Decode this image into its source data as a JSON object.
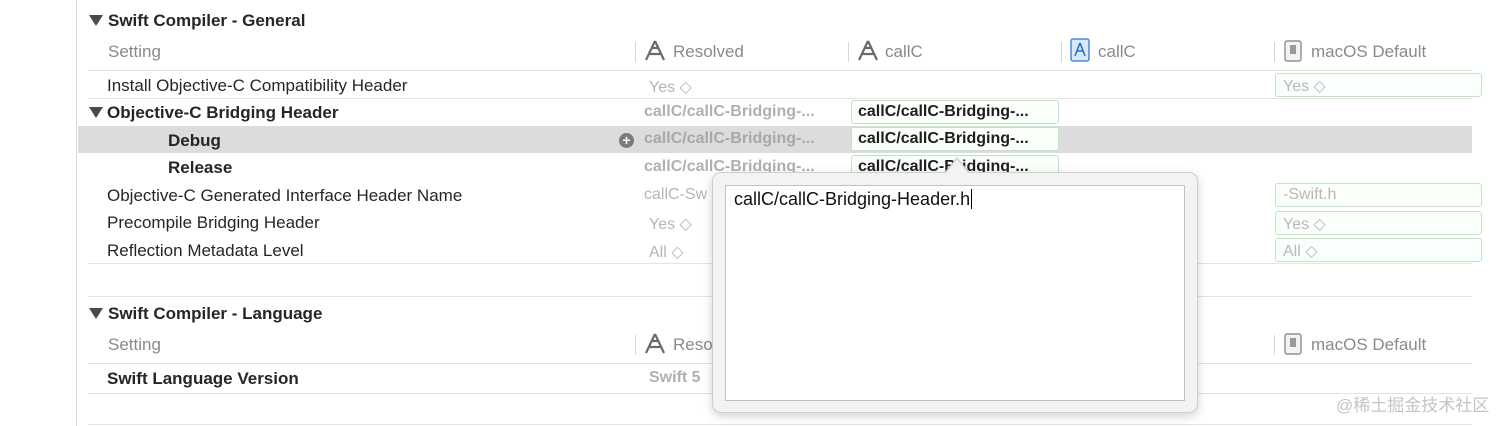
{
  "sections": {
    "general": {
      "title": "Swift Compiler - General",
      "header": {
        "setting": "Setting",
        "resolved": "Resolved",
        "target": "callC",
        "project": "callC",
        "default": "macOS Default"
      },
      "rows": {
        "install_header": {
          "label": "Install Objective-C Compatibility Header",
          "resolved": "Yes ◇",
          "default": "Yes ◇"
        },
        "bridging_header": {
          "label": "Objective-C Bridging Header",
          "resolved": "callC/callC-Bridging-...",
          "target": "callC/callC-Bridging-..."
        },
        "debug": {
          "label": "Debug",
          "resolved": "callC/callC-Bridging-...",
          "target": "callC/callC-Bridging-..."
        },
        "release": {
          "label": "Release",
          "resolved": "callC/callC-Bridging-...",
          "target": "callC/callC-Bridging-..."
        },
        "generated_interface": {
          "label": "Objective-C Generated Interface Header Name",
          "resolved": "callC-Sw",
          "default": "-Swift.h"
        },
        "precompile": {
          "label": "Precompile Bridging Header",
          "resolved": "Yes ◇",
          "default": "Yes ◇"
        },
        "reflection": {
          "label": "Reflection Metadata Level",
          "resolved": "All ◇",
          "default": "All ◇"
        }
      }
    },
    "language": {
      "title": "Swift Compiler - Language",
      "header": {
        "setting": "Setting",
        "resolved": "Reso",
        "default": "macOS Default"
      },
      "rows": {
        "swift_version": {
          "label": "Swift Language Version",
          "resolved": "Swift 5"
        }
      }
    }
  },
  "popover": {
    "value": "callC/callC-Bridging-Header.h"
  },
  "watermark": "@稀土掘金技术社区",
  "icons": [
    "disclosure-triangle-icon",
    "app-target-icon",
    "project-file-icon",
    "sdk-default-icon",
    "add-condition-icon"
  ],
  "colors": {
    "highlight": "#dcdcdc",
    "green_border": "#bfe6bf",
    "dim_text": "#b5b5b5"
  }
}
